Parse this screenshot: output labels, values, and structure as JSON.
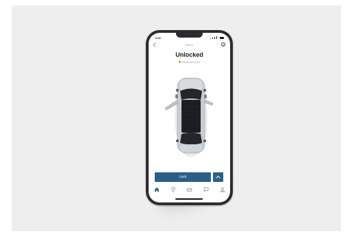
{
  "status_bar": {
    "time": "9:41"
  },
  "nav": {
    "title": "Doors",
    "back_icon": "chevron-left-icon",
    "info_icon": "info-icon",
    "info_glyph": "i"
  },
  "vehicle": {
    "lock_state": "Unlocked",
    "warning": "Windows open",
    "warning_color": "#e08a2e"
  },
  "actions": {
    "lock_label": "Lock",
    "accent_color": "#2c5f88",
    "expand_icon": "chevron-up-icon"
  },
  "tabbar": {
    "items": [
      {
        "icon": "home-icon",
        "active": true
      },
      {
        "icon": "map-pin-icon",
        "active": false
      },
      {
        "icon": "car-icon",
        "active": false
      },
      {
        "icon": "chat-icon",
        "active": false
      },
      {
        "icon": "profile-icon",
        "active": false
      }
    ]
  }
}
